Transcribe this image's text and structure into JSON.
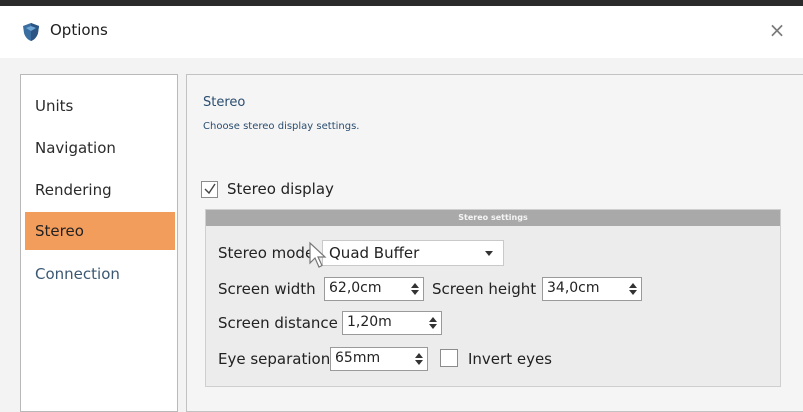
{
  "window": {
    "title": "Options",
    "close_glyph": "×"
  },
  "icons": {
    "app": "shield-icon",
    "close": "close-icon",
    "check": "checkmark-icon",
    "spinner": "spinner-arrows-icon",
    "dropdown": "chevron-down-icon",
    "cursor": "mouse-pointer-icon"
  },
  "colors": {
    "active_nav": "#f39d5c",
    "group_header": "#a9a9a9",
    "heading_text": "#2b4d6f"
  },
  "nav": {
    "items": [
      {
        "label": "Units",
        "active": false
      },
      {
        "label": "Navigation",
        "active": false
      },
      {
        "label": "Rendering",
        "active": false
      },
      {
        "label": "Stereo",
        "active": true
      },
      {
        "label": "Connection",
        "active": false
      }
    ]
  },
  "stereo": {
    "title": "Stereo",
    "description": "Choose stereo display settings.",
    "display_checkbox": {
      "label": "Stereo display",
      "checked": true
    },
    "group_title": "Stereo settings",
    "mode": {
      "label": "Stereo mode",
      "value": "Quad Buffer"
    },
    "screen_width": {
      "label": "Screen width",
      "value": "62,0cm"
    },
    "screen_height": {
      "label": "Screen height",
      "value": "34,0cm"
    },
    "screen_distance": {
      "label": "Screen distance",
      "value": "1,20m"
    },
    "eye_separation": {
      "label": "Eye separation",
      "value": "65mm"
    },
    "invert_eyes": {
      "label": "Invert eyes",
      "checked": false
    }
  }
}
